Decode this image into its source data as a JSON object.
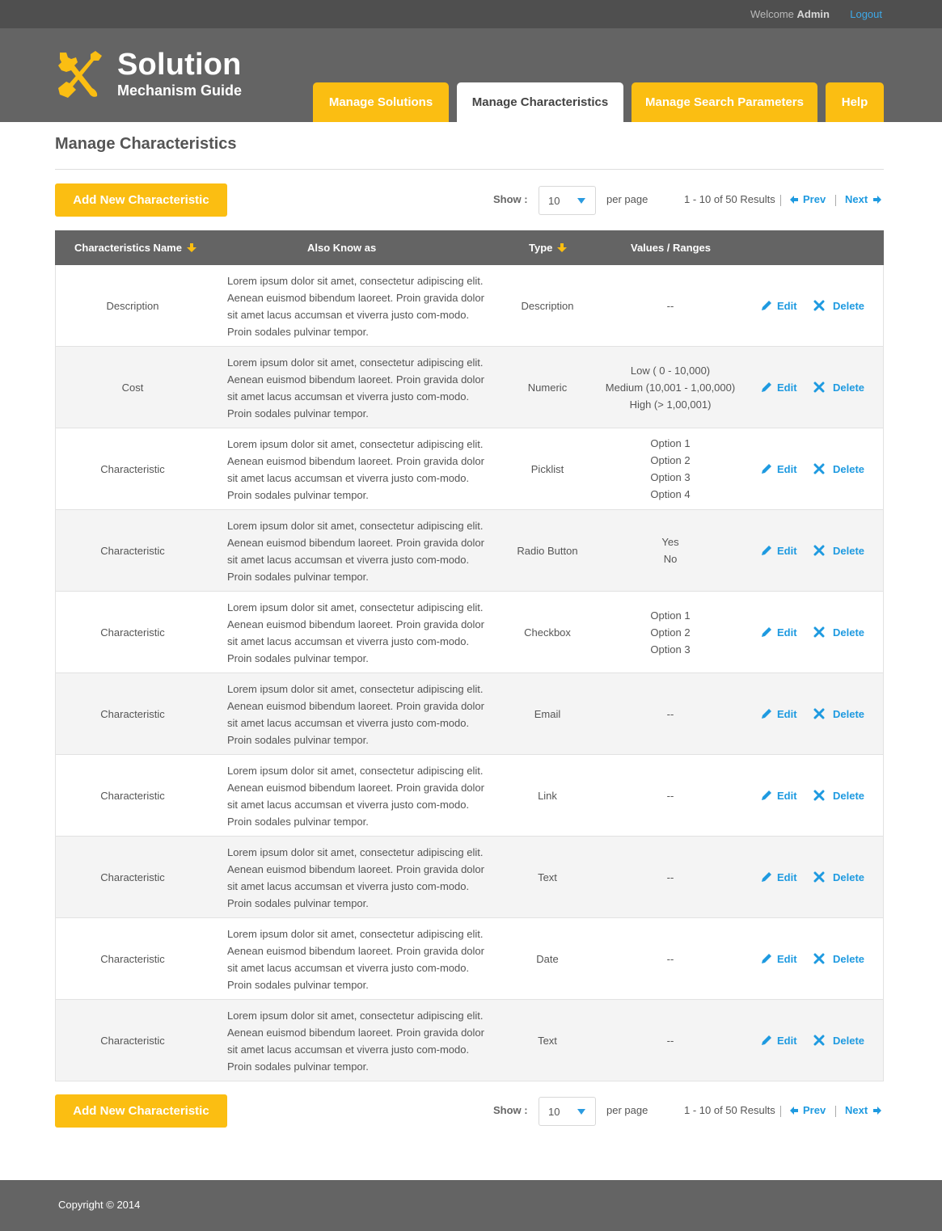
{
  "topbar": {
    "welcome": "Welcome",
    "user": "Admin",
    "logout": "Logout"
  },
  "logo": {
    "title": "Solution",
    "subtitle": "Mechanism Guide"
  },
  "tabs": [
    {
      "label": "Manage Solutions"
    },
    {
      "label": "Manage Characteristics"
    },
    {
      "label": "Manage Search Parameters"
    },
    {
      "label": "Help"
    }
  ],
  "page": {
    "title": "Manage Characteristics"
  },
  "toolbar": {
    "add_label": "Add New Characteristic",
    "show_label": "Show :",
    "per_page_value": "10",
    "per_page_label": "per page",
    "results": "1 - 10 of 50 Results",
    "prev": "Prev",
    "next": "Next"
  },
  "table": {
    "headers": {
      "name": "Characteristics Name",
      "aka": "Also Know as",
      "type": "Type",
      "values": "Values / Ranges"
    },
    "actions": {
      "edit": "Edit",
      "delete": "Delete"
    },
    "rows": [
      {
        "name": "Description",
        "desc": "Lorem ipsum dolor sit amet, consectetur adipiscing elit. Aenean euismod bibendum laoreet. Proin gravida dolor sit amet lacus accumsan et viverra justo com-modo. Proin sodales pulvinar tempor.",
        "type": "Description",
        "values": [
          "--"
        ]
      },
      {
        "name": "Cost",
        "desc": "Lorem ipsum dolor sit amet, consectetur adipiscing elit. Aenean euismod bibendum laoreet. Proin gravida dolor sit amet lacus accumsan et viverra justo com-modo. Proin sodales pulvinar tempor.",
        "type": "Numeric",
        "values": [
          "Low  ( 0 - 10,000)",
          "Medium (10,001 - 1,00,000)",
          "High (> 1,00,001)"
        ]
      },
      {
        "name": "Characteristic",
        "desc": "Lorem ipsum dolor sit amet, consectetur adipiscing elit. Aenean euismod bibendum laoreet. Proin gravida dolor sit amet lacus accumsan et viverra justo com-modo. Proin sodales pulvinar tempor.",
        "type": "Picklist",
        "values": [
          "Option 1",
          "Option 2",
          "Option 3",
          "Option 4"
        ]
      },
      {
        "name": "Characteristic",
        "desc": "Lorem ipsum dolor sit amet, consectetur adipiscing elit. Aenean euismod bibendum laoreet. Proin gravida dolor sit amet lacus accumsan et viverra justo com-modo. Proin sodales pulvinar tempor.",
        "type": "Radio Button",
        "values": [
          "Yes",
          "No"
        ]
      },
      {
        "name": "Characteristic",
        "desc": "Lorem ipsum dolor sit amet, consectetur adipiscing elit. Aenean euismod bibendum laoreet. Proin gravida dolor sit amet lacus accumsan et viverra justo com-modo. Proin sodales pulvinar tempor.",
        "type": "Checkbox",
        "values": [
          "Option 1",
          "Option 2",
          "Option 3"
        ]
      },
      {
        "name": "Characteristic",
        "desc": "Lorem ipsum dolor sit amet, consectetur adipiscing elit. Aenean euismod bibendum laoreet. Proin gravida dolor sit amet lacus accumsan et viverra justo com-modo. Proin sodales pulvinar tempor.",
        "type": "Email",
        "values": [
          "--"
        ]
      },
      {
        "name": "Characteristic",
        "desc": "Lorem ipsum dolor sit amet, consectetur adipiscing elit. Aenean euismod bibendum laoreet. Proin gravida dolor sit amet lacus accumsan et viverra justo com-modo. Proin sodales pulvinar tempor.",
        "type": "Link",
        "values": [
          "--"
        ]
      },
      {
        "name": "Characteristic",
        "desc": "Lorem ipsum dolor sit amet, consectetur adipiscing elit. Aenean euismod bibendum laoreet. Proin gravida dolor sit amet lacus accumsan et viverra justo com-modo. Proin sodales pulvinar tempor.",
        "type": "Text",
        "values": [
          "--"
        ]
      },
      {
        "name": "Characteristic",
        "desc": "Lorem ipsum dolor sit amet, consectetur adipiscing elit. Aenean euismod bibendum laoreet. Proin gravida dolor sit amet lacus accumsan et viverra justo com-modo. Proin sodales pulvinar tempor.",
        "type": "Date",
        "values": [
          "--"
        ]
      },
      {
        "name": "Characteristic",
        "desc": "Lorem ipsum dolor sit amet, consectetur adipiscing elit. Aenean euismod bibendum laoreet. Proin gravida dolor sit amet lacus accumsan et viverra justo com-modo. Proin sodales pulvinar tempor.",
        "type": "Text",
        "values": [
          "--"
        ]
      }
    ]
  },
  "footer": {
    "copyright": "Copyright © 2014"
  },
  "colors": {
    "accent": "#fbbe12",
    "link": "#1e9ae0",
    "header_bg": "#646464",
    "topbar_bg": "#4f4f4f"
  },
  "icons": [
    "tools-icon",
    "sort-down-icon",
    "arrow-left-icon",
    "arrow-right-icon",
    "pencil-icon",
    "close-icon",
    "chevron-down-icon"
  ]
}
